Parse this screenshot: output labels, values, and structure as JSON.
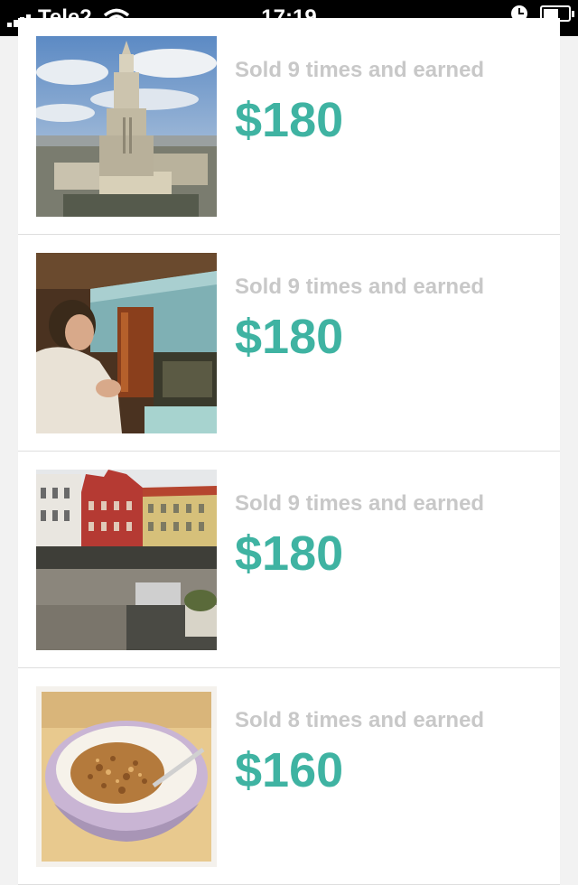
{
  "status_bar": {
    "carrier": "Tele2",
    "time": "17:19",
    "icons": [
      "signal-icon",
      "wifi-icon",
      "alarm-clock-icon",
      "battery-charging-icon"
    ]
  },
  "sales_list": [
    {
      "photo": "city-tower-photo",
      "sold_text": "Sold 9 times and earned",
      "amount": "$180"
    },
    {
      "photo": "woman-robe-photo",
      "sold_text": "Sold 9 times and earned",
      "amount": "$180"
    },
    {
      "photo": "town-square-photo",
      "sold_text": "Sold 9 times and earned",
      "amount": "$180"
    },
    {
      "photo": "cereal-bowl-photo",
      "sold_text": "Sold 8 times and earned",
      "amount": "$160"
    }
  ],
  "colors": {
    "accent": "#3fb3a2",
    "muted_text": "#c8c8c8",
    "card_bg": "#ffffff",
    "page_bg": "#f2f2f2",
    "status_bar_bg": "#000000"
  }
}
